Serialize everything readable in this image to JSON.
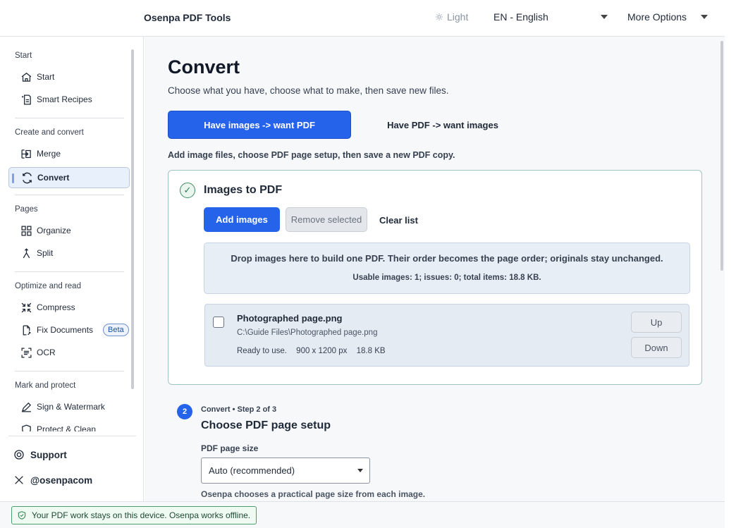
{
  "header": {
    "app_title": "Osenpa PDF Tools",
    "theme_label": "Light",
    "language": "EN - English",
    "more_options": "More Options"
  },
  "sidebar": {
    "sections": [
      {
        "title": "Start"
      },
      {
        "title": "Create and convert"
      },
      {
        "title": "Pages"
      },
      {
        "title": "Optimize and read"
      },
      {
        "title": "Mark and protect"
      }
    ],
    "items": [
      {
        "label": "Start",
        "icon": "home-icon"
      },
      {
        "label": "Smart Recipes",
        "icon": "recipes-icon"
      },
      {
        "label": "Merge",
        "icon": "merge-icon"
      },
      {
        "label": "Convert",
        "icon": "convert-icon",
        "active": true
      },
      {
        "label": "Organize",
        "icon": "grid-icon"
      },
      {
        "label": "Split",
        "icon": "split-icon"
      },
      {
        "label": "Compress",
        "icon": "compress-icon"
      },
      {
        "label": "Fix Documents",
        "icon": "fix-document-icon",
        "badge": "Beta"
      },
      {
        "label": "OCR",
        "icon": "ocr-icon"
      },
      {
        "label": "Sign & Watermark",
        "icon": "pen-icon"
      },
      {
        "label": "Protect & Clean",
        "icon": "shield-icon"
      }
    ],
    "support_label": "Support",
    "social_label": "@osenpacom"
  },
  "main": {
    "title": "Convert",
    "subtitle": "Choose what you have, choose what to make, then save new files.",
    "modes": [
      {
        "label": "Have images -> want PDF",
        "active": true
      },
      {
        "label": "Have PDF -> want images",
        "active": false
      }
    ],
    "mode_description": "Add image files, choose PDF page setup, then save a new PDF copy.",
    "card": {
      "title": "Images to PDF",
      "add_button": "Add images",
      "remove_button": "Remove selected",
      "clear_button": "Clear list",
      "drop_text": "Drop images here to build one PDF. Their order becomes the page order; originals stay unchanged.",
      "drop_stats": "Usable images: 1; issues: 0; total items: 18.8 KB.",
      "files": [
        {
          "name": "Photographed page.png",
          "path": "C:\\Guide Files\\Photographed page.png",
          "status": "Ready to use.",
          "dimensions": "900 x 1200 px",
          "size": "18.8 KB",
          "checked": false
        }
      ],
      "up_button": "Up",
      "down_button": "Down"
    },
    "step": {
      "number": "2",
      "eyebrow": "Convert • Step 2 of 3",
      "title": "Choose PDF page setup",
      "field_label": "PDF page size",
      "field_value": "Auto (recommended)",
      "field_help": "Osenpa chooses a practical page size from each image."
    }
  },
  "footer": {
    "privacy_text": "Your PDF work stays on this device. Osenpa works offline."
  },
  "colors": {
    "accent": "#2563eb",
    "success": "#49a06d",
    "active_nav_bg": "#e8f0fb"
  }
}
